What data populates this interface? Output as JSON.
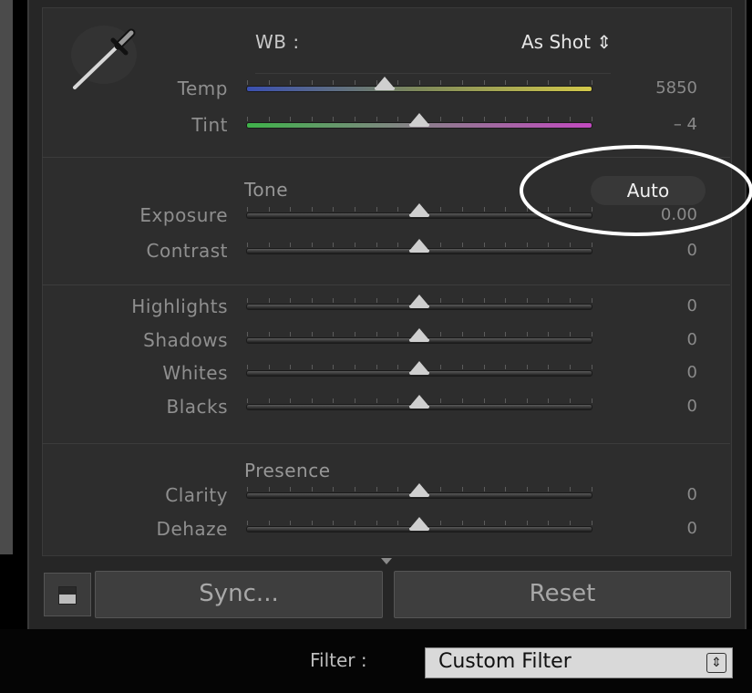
{
  "wb": {
    "label": "WB :",
    "preset": "As Shot ⇕"
  },
  "sliders": [
    {
      "key": "temp",
      "label": "Temp",
      "value": "5850",
      "pos": 0.4
    },
    {
      "key": "tint",
      "label": "Tint",
      "value": "– 4",
      "pos": 0.5
    },
    {
      "key": "exposure",
      "label": "Exposure",
      "value": "0.00",
      "pos": 0.5
    },
    {
      "key": "contrast",
      "label": "Contrast",
      "value": "0",
      "pos": 0.5
    },
    {
      "key": "highlights",
      "label": "Highlights",
      "value": "0",
      "pos": 0.5
    },
    {
      "key": "shadows",
      "label": "Shadows",
      "value": "0",
      "pos": 0.5
    },
    {
      "key": "whites",
      "label": "Whites",
      "value": "0",
      "pos": 0.5
    },
    {
      "key": "blacks",
      "label": "Blacks",
      "value": "0",
      "pos": 0.5
    },
    {
      "key": "clarity",
      "label": "Clarity",
      "value": "0",
      "pos": 0.5
    },
    {
      "key": "dehaze",
      "label": "Dehaze",
      "value": "0",
      "pos": 0.5
    }
  ],
  "tone": {
    "heading": "Tone",
    "auto_label": "Auto"
  },
  "presence": {
    "heading": "Presence"
  },
  "buttons": {
    "sync_label": "Sync...",
    "reset_label": "Reset"
  },
  "filter": {
    "label": "Filter :",
    "value": "Custom Filter"
  },
  "colors": {
    "panel": "#2b2b2b",
    "panel_dark": "#1f1f1f",
    "annotation": "#ffffff"
  }
}
